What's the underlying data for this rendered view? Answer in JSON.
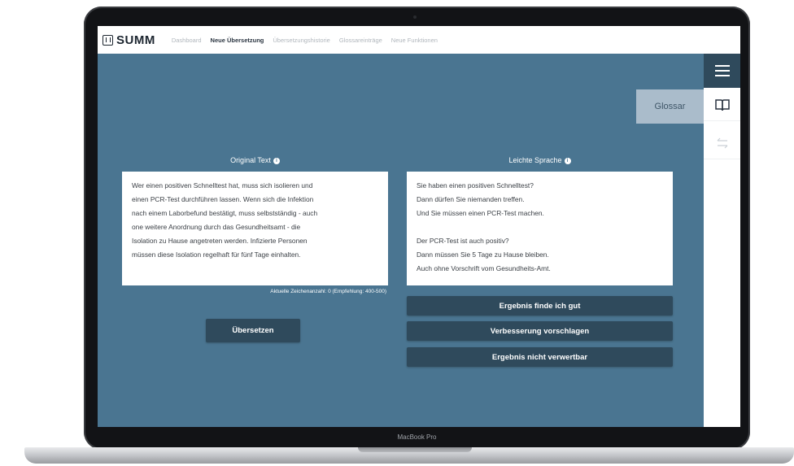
{
  "device": {
    "label": "MacBook Pro"
  },
  "app": {
    "brand": "SUMM",
    "nav": [
      {
        "label": "Dashboard",
        "active": false
      },
      {
        "label": "Neue Übersetzung",
        "active": true
      },
      {
        "label": "Übersetzungshistorie",
        "active": false
      },
      {
        "label": "Glossareinträge",
        "active": false
      },
      {
        "label": "Neue Funktionen",
        "active": false
      }
    ]
  },
  "sidebar": {
    "menu_icon": "hamburger-menu-icon",
    "glossar_label": "Glossar",
    "book_icon": "book-icon",
    "swap_icon": "swap-arrows-icon"
  },
  "original": {
    "title": "Original Text",
    "info_icon": "info-icon",
    "lines": [
      "Wer einen positiven Schnelltest hat, muss sich isolieren und",
      "einen PCR-Test durchführen lassen. Wenn sich die Infektion",
      "nach einem Laborbefund bestätigt, muss selbstständig - auch",
      "one weitere Anordnung durch das Gesundheitsamt - die",
      "Isolation zu Hause angetreten werden. Infizierte Personen",
      "müssen diese Isolation regelhaft für fünf Tage einhalten."
    ],
    "char_count": "Aktuelle Zeichenanzahl: 0 (Empfehlung: 400-500)",
    "translate_button": "Übersetzen"
  },
  "simple": {
    "title": "Leichte Sprache",
    "info_icon": "info-icon",
    "lines": [
      "Sie haben einen positiven Schnelltest?",
      "Dann dürfen Sie niemanden treffen.",
      "Und Sie müssen einen PCR-Test machen.",
      "",
      "Der PCR-Test ist auch positiv?",
      "Dann müssen Sie 5 Tage zu Hause bleiben.",
      "Auch ohne Vorschrift vom Gesundheits-Amt."
    ],
    "feedback_buttons": [
      "Ergebnis finde ich gut",
      "Verbesserung vorschlagen",
      "Ergebnis nicht verwertbar"
    ]
  },
  "colors": {
    "main_bg": "#4a7591",
    "button_bg": "#2f4a5c",
    "glossar_tab": "#aabccb"
  }
}
